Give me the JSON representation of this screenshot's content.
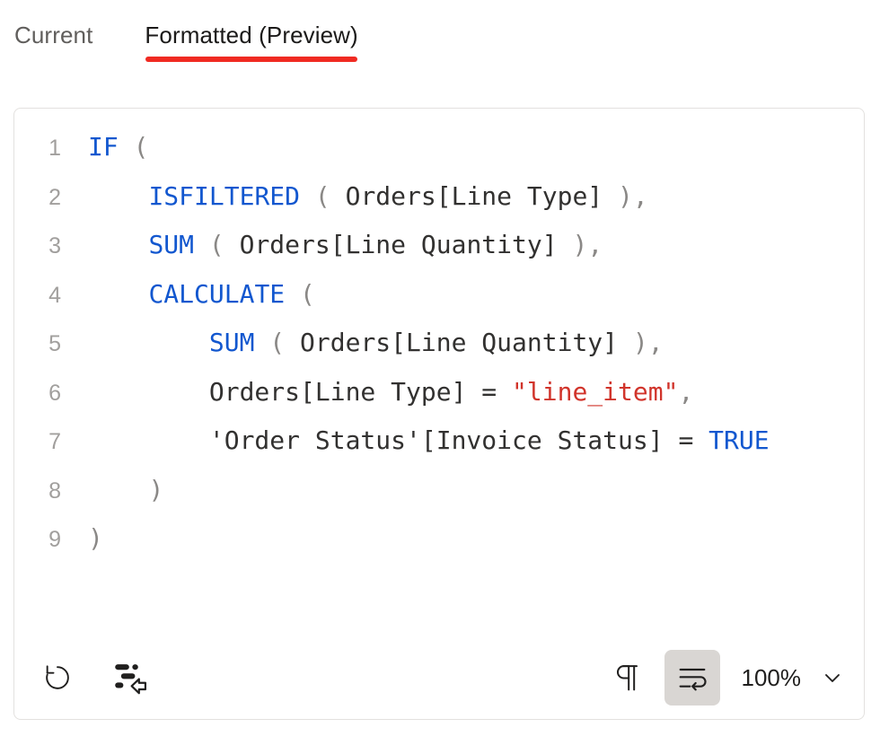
{
  "tabs": [
    {
      "label": "Current",
      "selected": false
    },
    {
      "label": "Formatted (Preview)",
      "selected": true
    }
  ],
  "accent_color": "#f02a22",
  "editor": {
    "language": "DAX",
    "keyword_color": "#1257cf",
    "string_color": "#d1342b",
    "text_color": "#323130",
    "line_number_color": "#a19f9d",
    "lines": [
      {
        "number": "1",
        "text": "IF ("
      },
      {
        "number": "2",
        "text": "    ISFILTERED ( Orders[Line Type] ),"
      },
      {
        "number": "3",
        "text": "    SUM ( Orders[Line Quantity] ),"
      },
      {
        "number": "4",
        "text": "    CALCULATE ("
      },
      {
        "number": "5",
        "text": "        SUM ( Orders[Line Quantity] ),"
      },
      {
        "number": "6",
        "text": "        Orders[Line Type] = \"line_item\","
      },
      {
        "number": "7",
        "text": "        'Order Status'[Invoice Status] = TRUE"
      },
      {
        "number": "8",
        "text": "    )"
      },
      {
        "number": "9",
        "text": ")"
      }
    ]
  },
  "toolbar": {
    "revert_icon": "undo-arrow-icon",
    "apply_format_icon": "format-apply-icon",
    "paragraph_marks_icon": "pilcrow-icon",
    "word_wrap_icon": "word-wrap-icon",
    "word_wrap_active": true,
    "zoom_level": "100%",
    "zoom_chevron_icon": "chevron-down-icon"
  }
}
